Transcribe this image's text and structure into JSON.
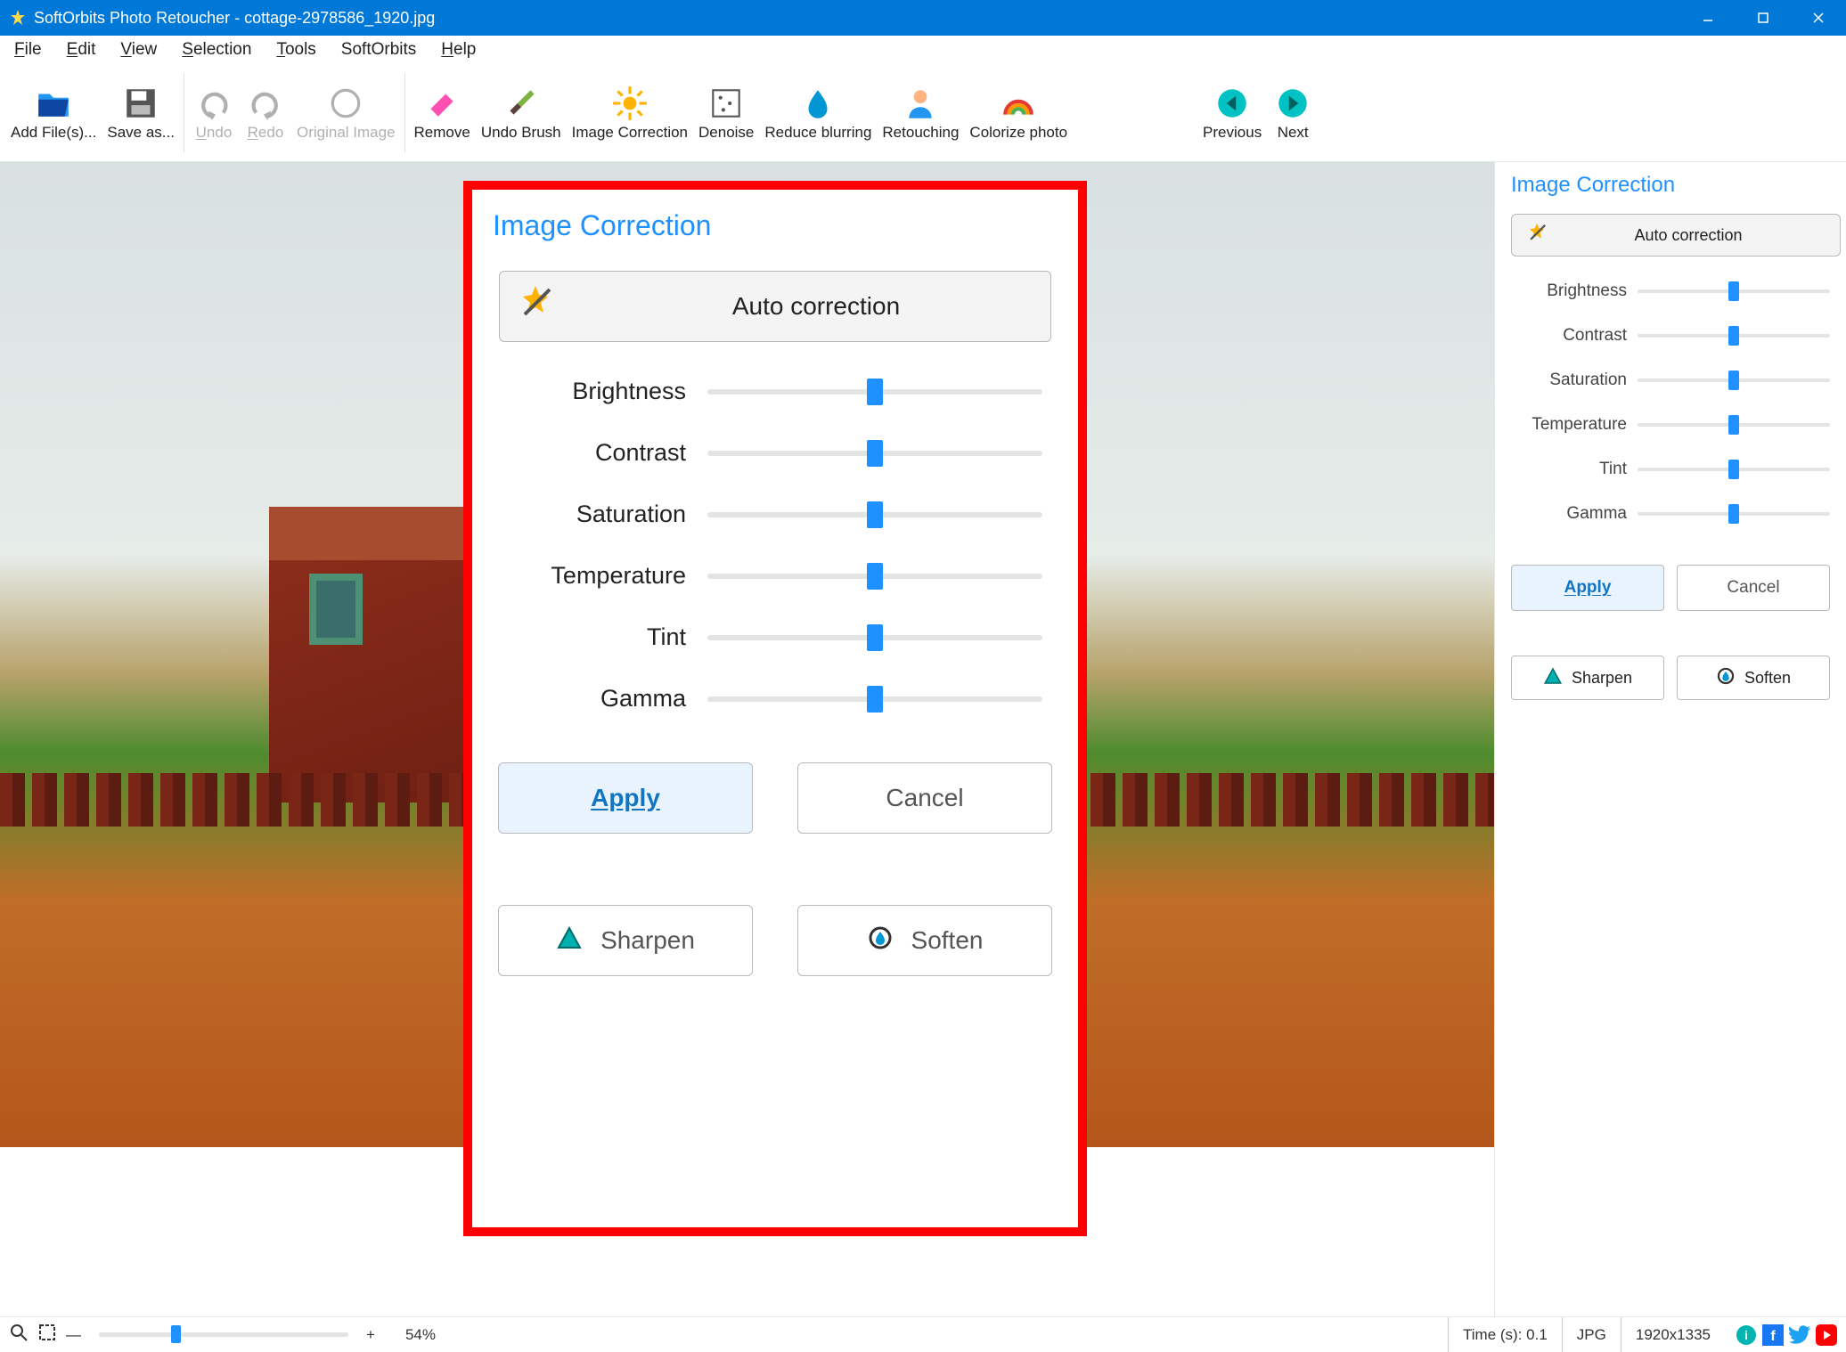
{
  "title": "SoftOrbits Photo Retoucher - cottage-2978586_1920.jpg",
  "menu": [
    "File",
    "Edit",
    "View",
    "Selection",
    "Tools",
    "SoftOrbits",
    "Help"
  ],
  "toolbar": {
    "add": "Add File(s)...",
    "save": "Save as...",
    "undo": "Undo",
    "redo": "Redo",
    "original": "Original Image",
    "remove": "Remove",
    "undobrush": "Undo Brush",
    "imgcorr": "Image Correction",
    "denoise": "Denoise",
    "reduce": "Reduce blurring",
    "retouch": "Retouching",
    "colorize": "Colorize photo",
    "prev": "Previous",
    "next": "Next"
  },
  "panel": {
    "title": "Image Correction",
    "auto": "Auto correction",
    "sliders": [
      "Brightness",
      "Contrast",
      "Saturation",
      "Temperature",
      "Tint",
      "Gamma"
    ],
    "apply": "Apply",
    "cancel": "Cancel",
    "sharpen": "Sharpen",
    "soften": "Soften"
  },
  "status": {
    "zoom": "54%",
    "time": "Time (s): 0.1",
    "format": "JPG",
    "dims": "1920x1335"
  }
}
